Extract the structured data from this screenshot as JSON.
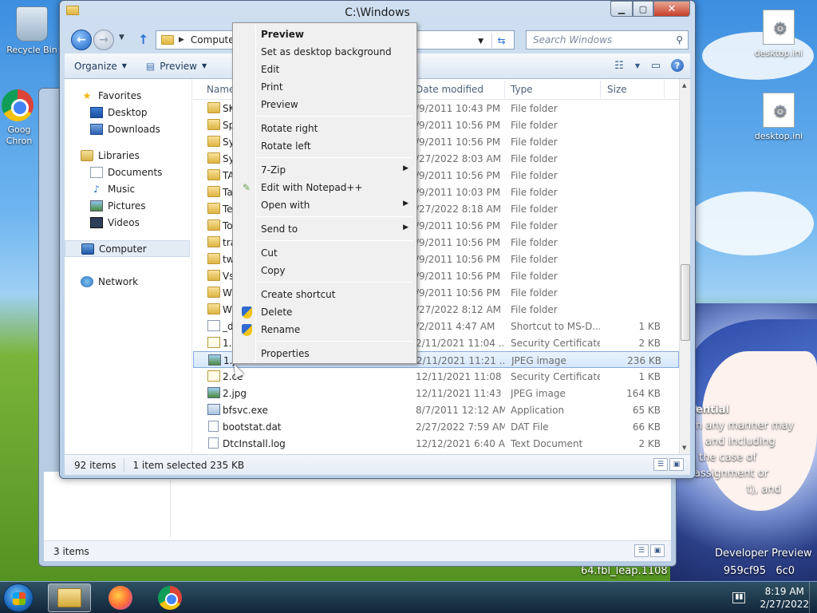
{
  "desktop": {
    "icons": [
      {
        "label": "Recycle Bin"
      },
      {
        "label": "Goog Chron"
      },
      {
        "label": "desktop.ini"
      },
      {
        "label": "desktop.ini"
      }
    ],
    "wallpaper_text": [
      "ential",
      "n any manner may",
      "and including",
      "the case of",
      "assignment or",
      "t), and"
    ],
    "watermark_line1": "Developer Preview",
    "watermark_line2": "64.fbl_leap.1108                 959cf95   6c0"
  },
  "background_window": {
    "status": "3 items"
  },
  "window": {
    "title": "C:\\Windows",
    "address": "Computer",
    "search_placeholder": "Search Windows",
    "toolbar": {
      "organize": "Organize",
      "preview": "Preview"
    },
    "nav": {
      "favorites": "Favorites",
      "desktop": "Desktop",
      "downloads": "Downloads",
      "libraries": "Libraries",
      "documents": "Documents",
      "music": "Music",
      "pictures": "Pictures",
      "videos": "Videos",
      "computer": "Computer",
      "network": "Network"
    },
    "columns": {
      "name": "Name",
      "date": "Date modified",
      "type": "Type",
      "size": "Size"
    },
    "files": [
      {
        "name": "SK",
        "date": "/9/2011 10:43 PM",
        "type": "File folder",
        "size": "",
        "icon": "folder"
      },
      {
        "name": "Sp",
        "date": "/9/2011 10:56 PM",
        "type": "File folder",
        "size": "",
        "icon": "folder"
      },
      {
        "name": "Sy",
        "date": "/9/2011 10:56 PM",
        "type": "File folder",
        "size": "",
        "icon": "folder"
      },
      {
        "name": "Sy",
        "date": "/27/2022 8:03 AM",
        "type": "File folder",
        "size": "",
        "icon": "folder"
      },
      {
        "name": "TA",
        "date": "/9/2011 10:56 PM",
        "type": "File folder",
        "size": "",
        "icon": "folder"
      },
      {
        "name": "Ta",
        "date": "/9/2011 10:03 PM",
        "type": "File folder",
        "size": "",
        "icon": "folder"
      },
      {
        "name": "Te",
        "date": "/27/2022 8:18 AM",
        "type": "File folder",
        "size": "",
        "icon": "folder"
      },
      {
        "name": "To",
        "date": "/9/2011 10:56 PM",
        "type": "File folder",
        "size": "",
        "icon": "folder"
      },
      {
        "name": "tra",
        "date": "/9/2011 10:56 PM",
        "type": "File folder",
        "size": "",
        "icon": "folder"
      },
      {
        "name": "tw",
        "date": "/9/2011 10:56 PM",
        "type": "File folder",
        "size": "",
        "icon": "folder"
      },
      {
        "name": "Vs",
        "date": "/9/2011 10:56 PM",
        "type": "File folder",
        "size": "",
        "icon": "folder"
      },
      {
        "name": "W",
        "date": "/9/2011 10:56 PM",
        "type": "File folder",
        "size": "",
        "icon": "folder"
      },
      {
        "name": "W",
        "date": "/27/2022 8:12 AM",
        "type": "File folder",
        "size": "",
        "icon": "folder"
      },
      {
        "name": "_d",
        "date": "/2/2011 4:47 AM",
        "type": "Shortcut to MS-D...",
        "size": "1 KB",
        "icon": "lnk"
      },
      {
        "name": "1.c",
        "date": "2/11/2021 11:04 ...",
        "type": "Security Certificate",
        "size": "2 KB",
        "icon": "cert"
      },
      {
        "name": "1.j",
        "date": "2/11/2021 11:21 ...",
        "type": "JPEG image",
        "size": "236 KB",
        "icon": "img",
        "selected": true
      },
      {
        "name": "2.ce",
        "date": "12/11/2021 11:08 ...",
        "type": "Security Certificate",
        "size": "1 KB",
        "icon": "cert"
      },
      {
        "name": "2.jpg",
        "date": "12/11/2021 11:43 ...",
        "type": "JPEG image",
        "size": "164 KB",
        "icon": "img"
      },
      {
        "name": "bfsvc.exe",
        "date": "8/7/2011 12:12 AM",
        "type": "Application",
        "size": "65 KB",
        "icon": "exe"
      },
      {
        "name": "bootstat.dat",
        "date": "2/27/2022 7:59 AM",
        "type": "DAT File",
        "size": "66 KB",
        "icon": "file"
      },
      {
        "name": "DtcInstall.log",
        "date": "12/12/2021 6:40 AM",
        "type": "Text Document",
        "size": "2 KB",
        "icon": "file"
      }
    ],
    "status": {
      "items": "92 items",
      "selection": "1 item selected  235 KB"
    }
  },
  "context_menu": {
    "items": [
      {
        "label": "Preview",
        "bold": true
      },
      {
        "label": "Set as desktop background"
      },
      {
        "label": "Edit"
      },
      {
        "label": "Print"
      },
      {
        "label": "Preview"
      },
      {
        "sep": true
      },
      {
        "label": "Rotate right"
      },
      {
        "label": "Rotate left"
      },
      {
        "sep": true
      },
      {
        "label": "7-Zip",
        "submenu": true
      },
      {
        "label": "Edit with Notepad++",
        "icon": "notepadpp-icon"
      },
      {
        "label": "Open with",
        "submenu": true
      },
      {
        "sep": true
      },
      {
        "label": "Send to",
        "submenu": true
      },
      {
        "sep": true
      },
      {
        "label": "Cut"
      },
      {
        "label": "Copy"
      },
      {
        "sep": true
      },
      {
        "label": "Create shortcut"
      },
      {
        "label": "Delete",
        "icon": "shield-icon"
      },
      {
        "label": "Rename",
        "icon": "shield-icon"
      },
      {
        "sep": true
      },
      {
        "label": "Properties"
      }
    ]
  },
  "taskbar": {
    "time": "8:19 AM",
    "date": "2/27/2022"
  }
}
